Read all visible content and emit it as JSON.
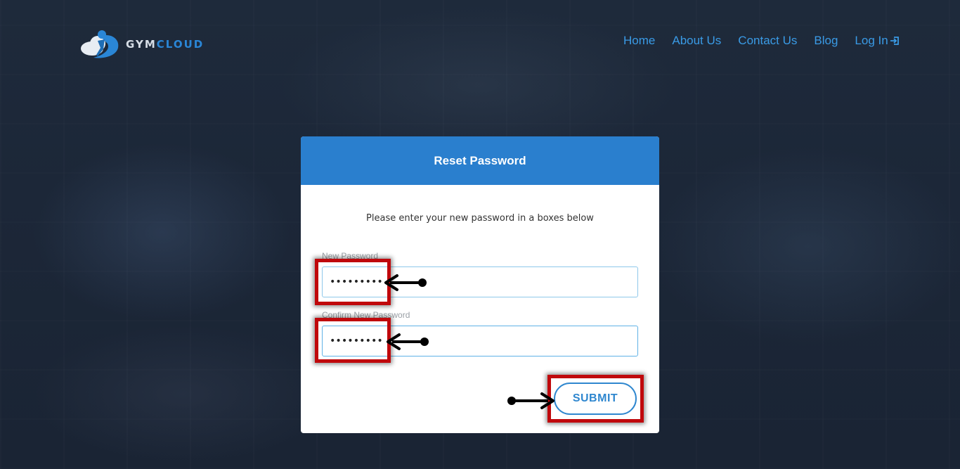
{
  "brand": {
    "name_part1": "GYM",
    "name_part2": "CLOUD",
    "colors": {
      "primary": "#2a7fce",
      "nav_link": "#3a9be6",
      "highlight": "#c0080c"
    }
  },
  "nav": {
    "items": [
      {
        "label": "Home"
      },
      {
        "label": "About Us"
      },
      {
        "label": "Contact Us"
      },
      {
        "label": "Blog"
      },
      {
        "label": "Log In",
        "icon": "login-icon"
      }
    ]
  },
  "reset_card": {
    "title": "Reset Password",
    "instruction": "Please enter your new password in a boxes below",
    "new_password": {
      "label": "New Password",
      "value": "•••••••••"
    },
    "confirm_password": {
      "label": "Confirm New Password",
      "value": "•••••••••"
    },
    "submit_label": "SUBMIT"
  }
}
